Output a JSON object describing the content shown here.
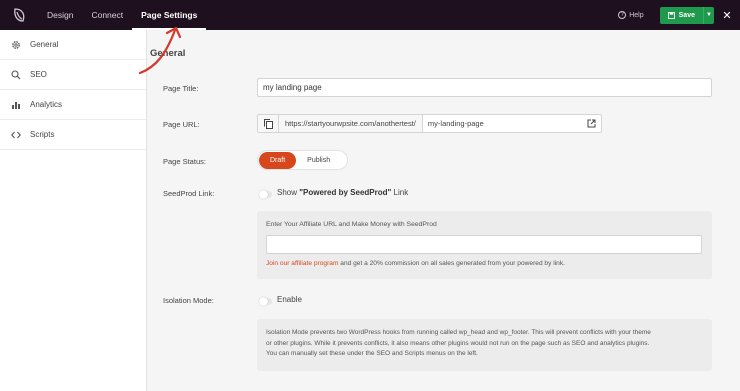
{
  "topbar": {
    "tabs": [
      {
        "label": "Design"
      },
      {
        "label": "Connect"
      },
      {
        "label": "Page Settings"
      }
    ],
    "help_label": "Help",
    "save_label": "Save"
  },
  "sidebar": {
    "items": [
      {
        "label": "General",
        "icon": "gear-icon"
      },
      {
        "label": "SEO",
        "icon": "search-icon"
      },
      {
        "label": "Analytics",
        "icon": "bar-chart-icon"
      },
      {
        "label": "Scripts",
        "icon": "code-icon"
      }
    ]
  },
  "main": {
    "section_title": "General",
    "page_title": {
      "label": "Page Title:",
      "value": "my landing page"
    },
    "page_url": {
      "label": "Page URL:",
      "prefix": "https://startyourwpsite.com/anothertest/",
      "slug": "my-landing-page"
    },
    "page_status": {
      "label": "Page Status:",
      "options": [
        "Draft",
        "Publish"
      ],
      "selected": "Draft"
    },
    "seedprod_link": {
      "label": "SeedProd Link:",
      "toggle_text_pre": "Show ",
      "toggle_text_bold": "\"Powered by SeedProd\"",
      "toggle_text_post": " Link",
      "enabled": false,
      "affiliate_label": "Enter Your Affiliate URL and Make Money with SeedProd",
      "affiliate_value": "",
      "affiliate_link_text": "Join our affiliate program",
      "affiliate_note": " and get a 20% commission on all sales generated from your powered by link."
    },
    "isolation_mode": {
      "label": "Isolation Mode:",
      "toggle_text": "Enable",
      "enabled": false,
      "description_lines": [
        "Isolation Mode prevents two WordPress hooks from running called wp_head and wp_footer. This will prevent conflicts with your theme",
        "or other plugins. While it prevents conflicts, it also means other plugins would not run on the page such as SEO and analytics plugins.",
        "You can manually set these under the SEO and Scripts menus on the left."
      ]
    }
  },
  "colors": {
    "topbar_bg": "#1f1020",
    "save_green": "#1f9a4c",
    "accent_orange": "#d6471e",
    "annotation_red": "#d33a2c"
  }
}
